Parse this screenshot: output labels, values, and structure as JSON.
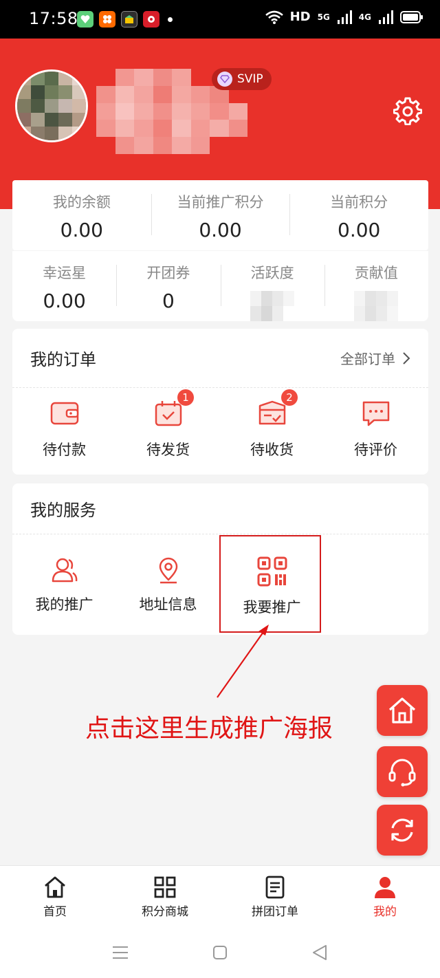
{
  "status_bar": {
    "time": "17:58",
    "network": "HD",
    "signal1": "5G",
    "signal2": "4G"
  },
  "profile": {
    "badge": "SVIP"
  },
  "stats_row1": [
    {
      "label": "我的余额",
      "value": "0.00"
    },
    {
      "label": "当前推广积分",
      "value": "0.00"
    },
    {
      "label": "当前积分",
      "value": "0.00"
    }
  ],
  "stats_row2": [
    {
      "label": "幸运星",
      "value": "0.00"
    },
    {
      "label": "开团券",
      "value": "0"
    },
    {
      "label": "活跃度"
    },
    {
      "label": "贡献值"
    }
  ],
  "orders": {
    "title": "我的订单",
    "all_label": "全部订单",
    "items": [
      {
        "label": "待付款",
        "icon": "wallet-icon"
      },
      {
        "label": "待发货",
        "icon": "calendar-box-icon",
        "badge": "1"
      },
      {
        "label": "待收货",
        "icon": "package-icon",
        "badge": "2"
      },
      {
        "label": "待评价",
        "icon": "chat-bubble-icon"
      }
    ]
  },
  "services": {
    "title": "我的服务",
    "items": [
      {
        "label": "我的推广",
        "icon": "users-icon"
      },
      {
        "label": "地址信息",
        "icon": "location-pin-icon"
      },
      {
        "label": "我要推广",
        "icon": "qr-code-icon"
      }
    ]
  },
  "annotation": "点击这里生成推广海报",
  "tabs": [
    {
      "label": "首页",
      "icon": "home-icon"
    },
    {
      "label": "积分商城",
      "icon": "grid-icon"
    },
    {
      "label": "拼团订单",
      "icon": "document-icon"
    },
    {
      "label": "我的",
      "icon": "person-icon",
      "active": true
    }
  ],
  "colors": {
    "primary": "#e8312a",
    "badge": "#f04a3e",
    "annotation": "#e01515"
  }
}
